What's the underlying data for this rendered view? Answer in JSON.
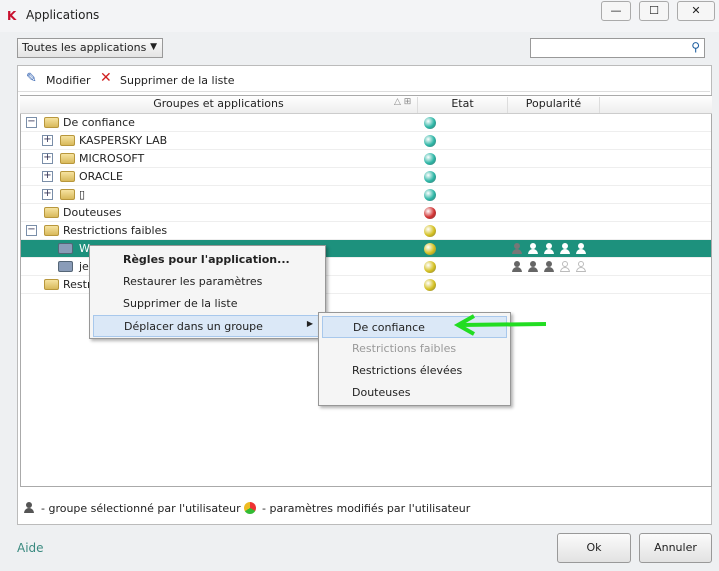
{
  "window": {
    "title": "Applications",
    "controls": [
      "minimize",
      "maximize",
      "close"
    ]
  },
  "filter": {
    "selected": "Toutes les applications"
  },
  "search": {
    "value": "",
    "placeholder": ""
  },
  "toolbar": {
    "modify": "Modifier",
    "remove": "Supprimer de la liste"
  },
  "columns": {
    "groups": "Groupes et applications",
    "state": "Etat",
    "popularity": "Popularité"
  },
  "rows": [
    {
      "label": "De confiance",
      "level": 0,
      "toggle": "−",
      "type": "folder",
      "state": "#2bb5a5"
    },
    {
      "label": "KASPERSKY LAB",
      "level": 1,
      "toggle": "+",
      "type": "folder",
      "state": "#2bb5a5"
    },
    {
      "label": "MICROSOFT",
      "level": 1,
      "toggle": "+",
      "type": "folder",
      "state": "#2bb5a5"
    },
    {
      "label": "ORACLE",
      "level": 1,
      "toggle": "+",
      "type": "folder",
      "state": "#2bb5a5"
    },
    {
      "label": "▯",
      "level": 1,
      "toggle": "+",
      "type": "folder",
      "state": "#2bb5a5"
    },
    {
      "label": "Douteuses",
      "level": 0,
      "toggle": "",
      "type": "folder",
      "state": "#d03030"
    },
    {
      "label": "Restrictions faibles",
      "level": 0,
      "toggle": "−",
      "type": "folder",
      "state": "#d4c020"
    },
    {
      "label": "W",
      "level": 1,
      "toggle": "",
      "type": "app",
      "state": "#d4c020",
      "selected": true,
      "popularity": 5,
      "user_selected": 1
    },
    {
      "label": "jeu",
      "level": 1,
      "toggle": "",
      "type": "app",
      "state": "#d4c020",
      "popularity": 3
    },
    {
      "label": "Restri",
      "level": 0,
      "toggle": "",
      "type": "folder",
      "state": "#d4c020"
    }
  ],
  "context_menu": {
    "items": [
      "Règles pour l'application...",
      "Restaurer les paramètres",
      "Supprimer de la liste",
      "Déplacer dans un groupe"
    ]
  },
  "submenu": {
    "items": [
      "De confiance",
      "Restrictions faibles",
      "Restrictions élevées",
      "Douteuses"
    ],
    "highlighted": 0,
    "disabled": 1
  },
  "annotation": {
    "arrow_color": "#22dd22"
  },
  "legend": {
    "user_group": "- groupe sélectionné par l'utilisateur",
    "modified": "- paramètres modifiés par l'utilisateur"
  },
  "footer": {
    "help": "Aide",
    "ok": "Ok",
    "cancel": "Annuler"
  },
  "colors": {
    "selection": "#1d917d",
    "accent": "#3a8a80"
  }
}
